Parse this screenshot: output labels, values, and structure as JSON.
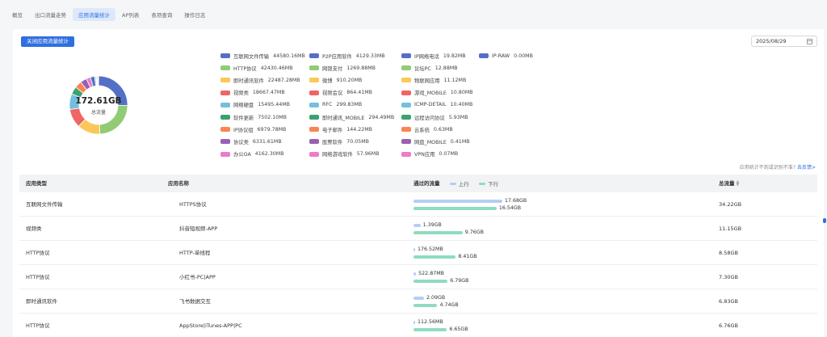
{
  "tabs": [
    {
      "label": "概览",
      "active": false
    },
    {
      "label": "出口流量走势",
      "active": false
    },
    {
      "label": "应用流量统计",
      "active": true
    },
    {
      "label": "AP列表",
      "active": false
    },
    {
      "label": "表项查询",
      "active": false
    },
    {
      "label": "操作日志",
      "active": false
    }
  ],
  "close_button_label": "关闭应用流量统计",
  "date": "2025/08/29",
  "donut": {
    "total": "172.61GB",
    "label": "总流量"
  },
  "legend": [
    {
      "name": "互联网文件传输",
      "value": "44580.16MB",
      "color": "#5470c6"
    },
    {
      "name": "P2P应用软件",
      "value": "4129.33MB",
      "color": "#5470c6"
    },
    {
      "name": "IP网络电话",
      "value": "19.82MB",
      "color": "#5470c6"
    },
    {
      "name": "IP-RAW",
      "value": "0.00MB",
      "color": "#5470c6"
    },
    {
      "name": "HTTP协议",
      "value": "42430.46MB",
      "color": "#91cc75"
    },
    {
      "name": "网银支付",
      "value": "1269.88MB",
      "color": "#91cc75"
    },
    {
      "name": "论坛PC",
      "value": "12.88MB",
      "color": "#91cc75"
    },
    {
      "name": "即时通讯软件",
      "value": "22487.28MB",
      "color": "#fac858"
    },
    {
      "name": "微博",
      "value": "910.20MB",
      "color": "#fac858"
    },
    {
      "name": "物联网应用",
      "value": "11.12MB",
      "color": "#fac858"
    },
    {
      "name": "视频类",
      "value": "18667.47MB",
      "color": "#ee6666"
    },
    {
      "name": "视频会议",
      "value": "864.41MB",
      "color": "#ee6666"
    },
    {
      "name": "游戏_MOBILE",
      "value": "10.80MB",
      "color": "#ee6666"
    },
    {
      "name": "网络硬盘",
      "value": "15495.44MB",
      "color": "#73c0de"
    },
    {
      "name": "RFC",
      "value": "299.83MB",
      "color": "#73c0de"
    },
    {
      "name": "ICMP-DETAIL",
      "value": "10.40MB",
      "color": "#73c0de"
    },
    {
      "name": "软件更新",
      "value": "7502.10MB",
      "color": "#3ba272"
    },
    {
      "name": "即时通讯_MOBILE",
      "value": "294.49MB",
      "color": "#3ba272"
    },
    {
      "name": "远程访问协议",
      "value": "5.93MB",
      "color": "#3ba272"
    },
    {
      "name": "IP协议组",
      "value": "6979.78MB",
      "color": "#fc8452"
    },
    {
      "name": "电子邮件",
      "value": "144.22MB",
      "color": "#fc8452"
    },
    {
      "name": "云系统",
      "value": "0.63MB",
      "color": "#fc8452"
    },
    {
      "name": "协议类",
      "value": "6331.61MB",
      "color": "#9a60b4"
    },
    {
      "name": "股票软件",
      "value": "70.05MB",
      "color": "#9a60b4"
    },
    {
      "name": "网盘_MOBILE",
      "value": "0.41MB",
      "color": "#9a60b4"
    },
    {
      "name": "办公OA",
      "value": "4162.30MB",
      "color": "#ea7ccc"
    },
    {
      "name": "网络游戏软件",
      "value": "57.96MB",
      "color": "#ea7ccc"
    },
    {
      "name": "VPN应用",
      "value": "0.07MB",
      "color": "#ea7ccc"
    }
  ],
  "hint": {
    "text": "应用统计不到或识别不准?",
    "link": "去反馈>"
  },
  "table": {
    "headers": {
      "type": "应用类型",
      "name": "应用名称",
      "traffic": "通过的流量",
      "up": "上行",
      "down": "下行",
      "total": "总流量"
    },
    "up_color": "#b5cdf5",
    "down_color": "#8fdcbf",
    "rows": [
      {
        "type": "互联网文件传输",
        "name": "HTTPS协议",
        "up": "17.68GB",
        "up_gb": 17.68,
        "down": "16.54GB",
        "down_gb": 16.54,
        "total": "34.22GB"
      },
      {
        "type": "视频类",
        "name": "抖音短视频-APP",
        "up": "1.39GB",
        "up_gb": 1.39,
        "down": "9.76GB",
        "down_gb": 9.76,
        "total": "11.15GB"
      },
      {
        "type": "HTTP协议",
        "name": "HTTP-单线程",
        "up": "176.52MB",
        "up_gb": 0.17,
        "down": "8.41GB",
        "down_gb": 8.41,
        "total": "8.58GB"
      },
      {
        "type": "HTTP协议",
        "name": "小红书-PC|APP",
        "up": "522.87MB",
        "up_gb": 0.51,
        "down": "6.79GB",
        "down_gb": 6.79,
        "total": "7.30GB"
      },
      {
        "type": "即时通讯软件",
        "name": "飞书数据交互",
        "up": "2.09GB",
        "up_gb": 2.09,
        "down": "4.74GB",
        "down_gb": 4.74,
        "total": "6.83GB"
      },
      {
        "type": "HTTP协议",
        "name": "AppStore|iTunes-APP|PC",
        "up": "112.56MB",
        "up_gb": 0.11,
        "down": "6.65GB",
        "down_gb": 6.65,
        "total": "6.76GB"
      }
    ]
  },
  "donut_segments_mb": [
    44580.16,
    42430.46,
    22487.28,
    18667.47,
    15495.44,
    7502.1,
    6979.78,
    6331.61,
    4162.3,
    4129.33,
    1269.88,
    910.2,
    864.41,
    299.83,
    294.49,
    144.22,
    70.05,
    57.96
  ],
  "donut_colors": [
    "#5470c6",
    "#91cc75",
    "#fac858",
    "#ee6666",
    "#73c0de",
    "#3ba272",
    "#fc8452",
    "#9a60b4",
    "#ea7ccc",
    "#5470c6",
    "#91cc75",
    "#fac858",
    "#ee6666",
    "#73c0de",
    "#3ba272",
    "#fc8452",
    "#9a60b4",
    "#ea7ccc"
  ]
}
